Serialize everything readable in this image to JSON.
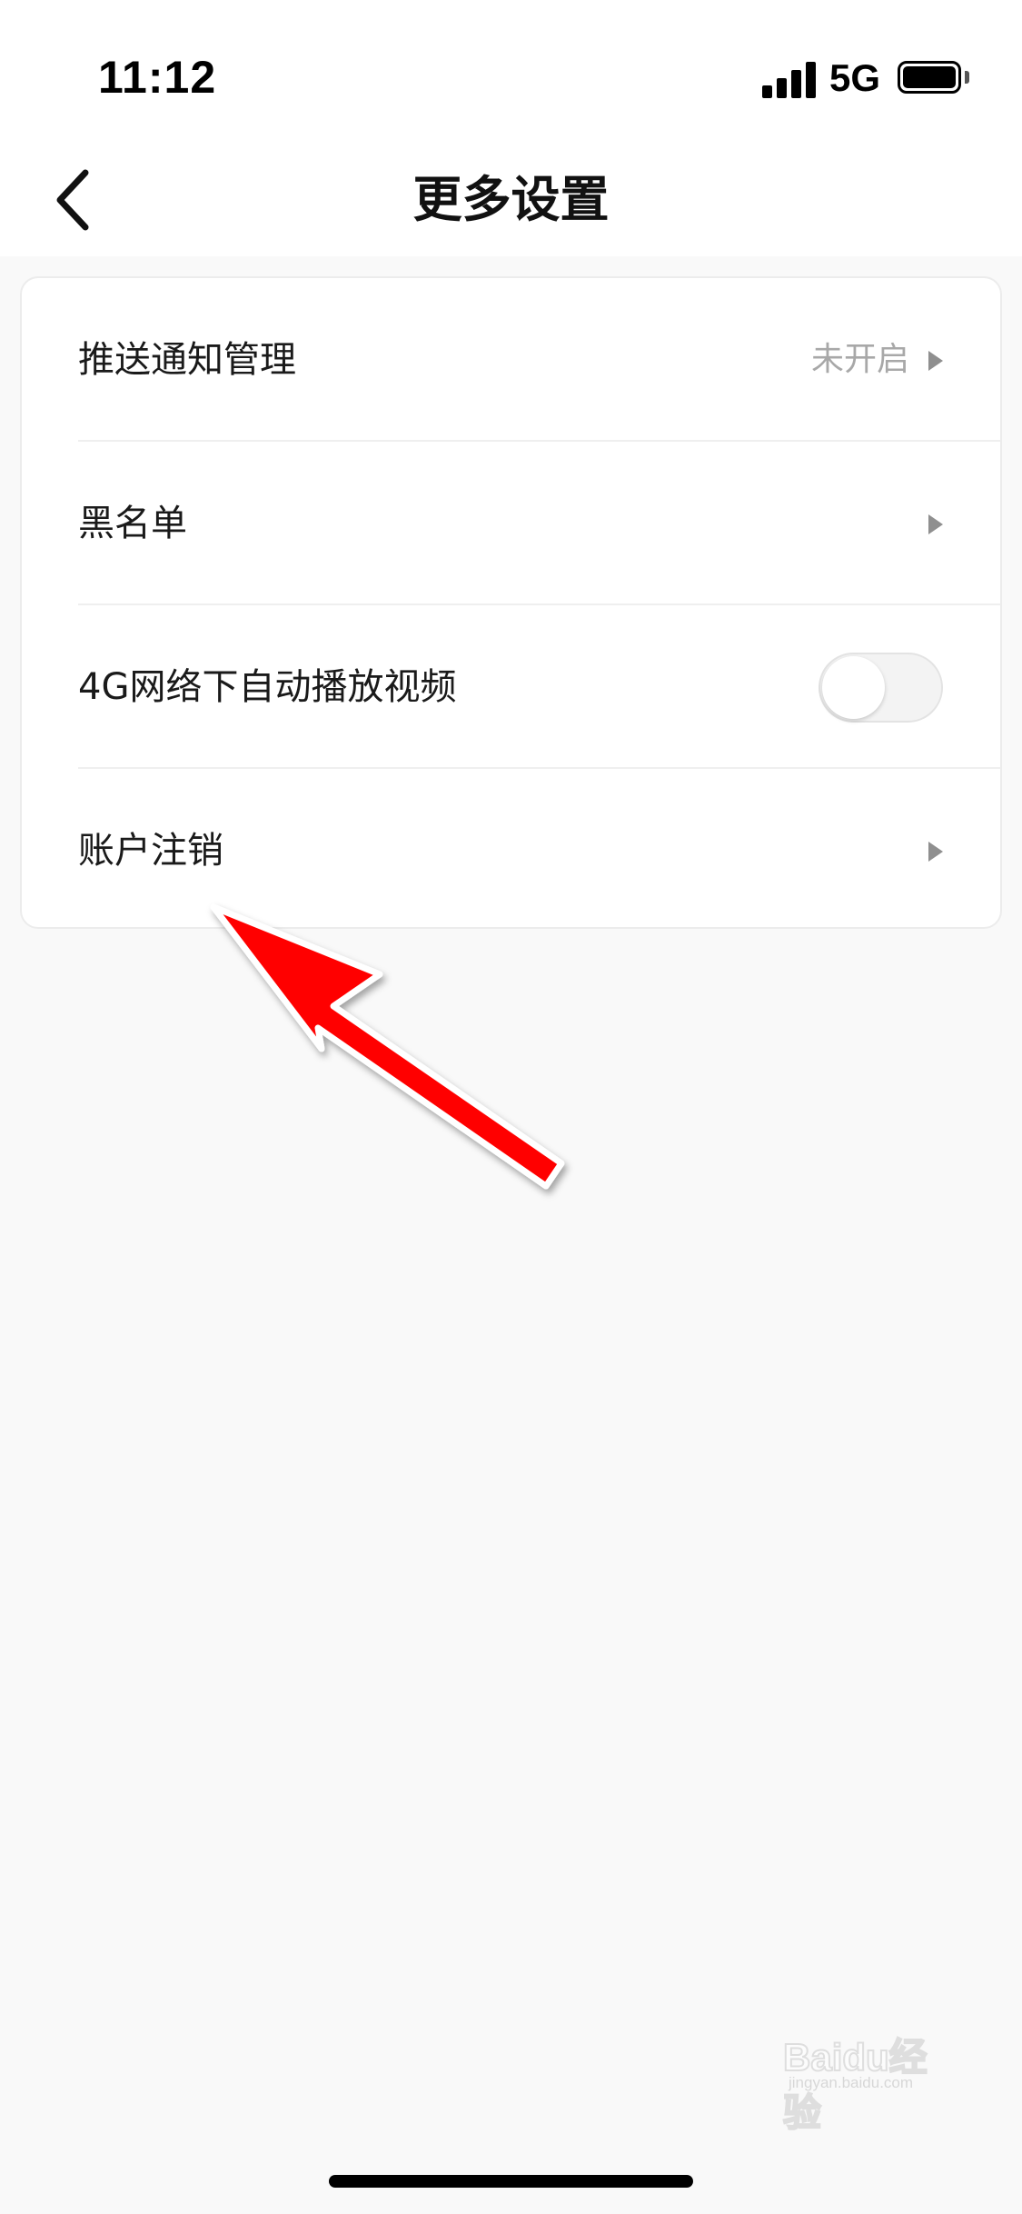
{
  "status_bar": {
    "time": "11:12",
    "network": "5G",
    "icons": [
      "signal-icon",
      "battery-icon"
    ]
  },
  "header": {
    "title": "更多设置",
    "back_icon": "chevron-left-icon"
  },
  "settings": [
    {
      "label": "推送通知管理",
      "value": "未开启",
      "control": "chevron"
    },
    {
      "label": "黑名单",
      "value": "",
      "control": "chevron"
    },
    {
      "label": "4G网络下自动播放视频",
      "value": "",
      "control": "toggle",
      "toggle_on": false
    },
    {
      "label": "账户注销",
      "value": "",
      "control": "chevron"
    }
  ],
  "annotation": {
    "arrow_color": "#ff0000",
    "target": "账户注销"
  },
  "watermark": {
    "brand": "Baidu经验",
    "sub": "jingyan.baidu.com"
  },
  "colors": {
    "background": "#f9f9f9",
    "card": "#ffffff",
    "secondary_text": "#a8a8a8",
    "chevron": "#8f8f8f"
  }
}
